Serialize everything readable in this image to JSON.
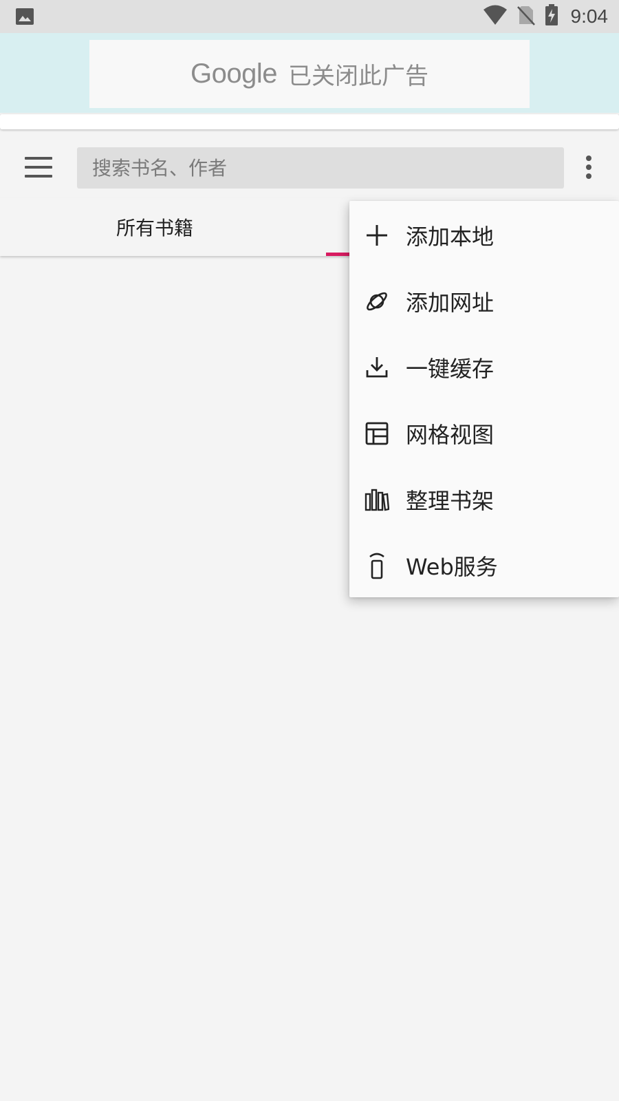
{
  "status_bar": {
    "time": "9:04",
    "icons": [
      "image-icon",
      "wifi-icon",
      "no-sim-icon",
      "battery-charging-icon"
    ]
  },
  "ad": {
    "logo": "Google",
    "text": "已关闭此广告"
  },
  "toolbar": {
    "search_placeholder": "搜索书名、作者"
  },
  "tabs": [
    {
      "label": "所有书籍",
      "selected": false
    }
  ],
  "colors": {
    "accent": "#d81b60",
    "ad_background": "#d8eff1",
    "page_background": "#f4f4f4"
  },
  "menu": {
    "items": [
      {
        "label": "添加本地",
        "icon": "plus-icon"
      },
      {
        "label": "添加网址",
        "icon": "planet-icon"
      },
      {
        "label": "一键缓存",
        "icon": "download-icon"
      },
      {
        "label": "网格视图",
        "icon": "grid-view-icon"
      },
      {
        "label": "整理书架",
        "icon": "bookshelf-icon"
      },
      {
        "label": "Web服务",
        "icon": "web-service-icon"
      }
    ]
  }
}
